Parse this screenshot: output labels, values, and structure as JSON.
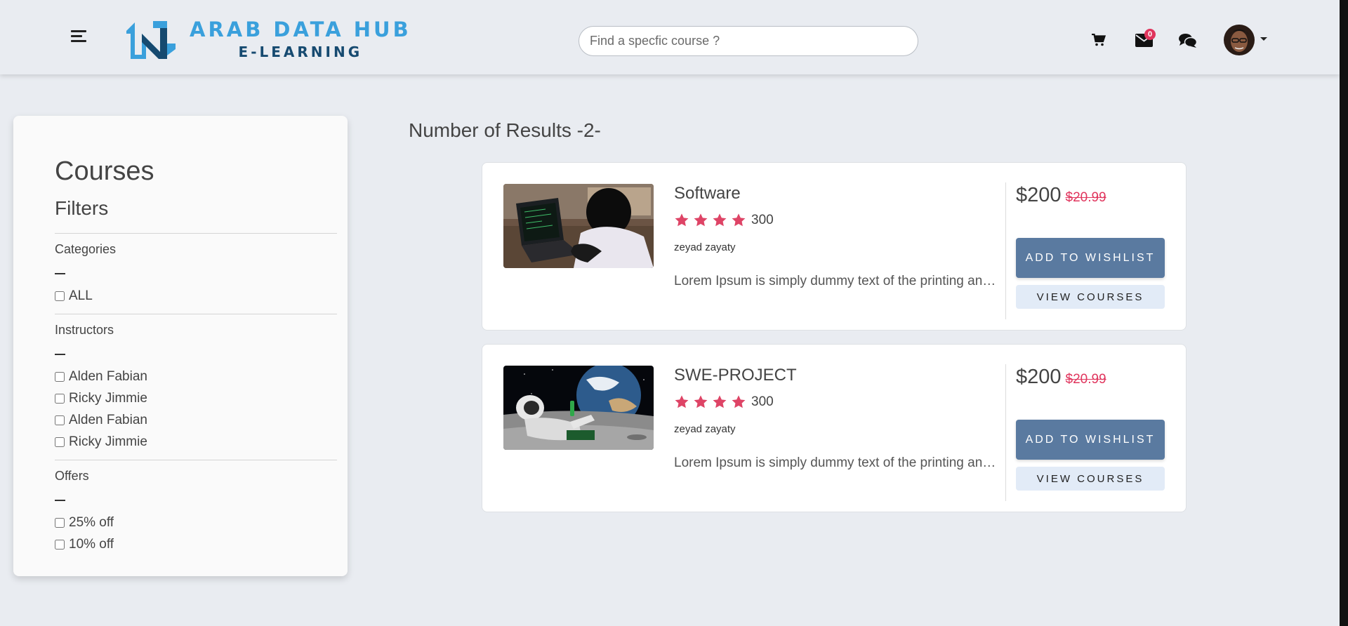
{
  "header": {
    "logo_title": "ARAB DATA HUB",
    "logo_subtitle": "E-LEARNING",
    "search_placeholder": "Find a specfic course ?",
    "messages_badge": "0",
    "icons": [
      "menu-icon",
      "cart-icon",
      "envelope-icon",
      "chat-icon",
      "avatar",
      "caret-down-icon"
    ],
    "colors": {
      "brand_light": "#3aa0dc",
      "brand_dark": "#164a70",
      "badge": "#e0355d"
    }
  },
  "sidebar": {
    "title": "Courses",
    "subtitle": "Filters",
    "categories": {
      "label": "Categories",
      "options": [
        "ALL"
      ]
    },
    "instructors": {
      "label": "Instructors",
      "options": [
        "Alden Fabian",
        "Ricky Jimmie",
        "Alden Fabian",
        "Ricky Jimmie"
      ]
    },
    "offers": {
      "label": "Offers",
      "options": [
        "25% off",
        "10% off"
      ]
    }
  },
  "results": {
    "count_label": "Number of Results -2-",
    "courses": [
      {
        "title": "Software",
        "rating_stars": 4,
        "rating_count": "300",
        "instructor": "zeyad zayaty",
        "description": "Lorem Ipsum is simply dummy text of the printing and typesetting industry.",
        "price": "$200",
        "old_price": "$20.99",
        "wishlist_label": "ADD TO WISHLIST",
        "view_label": "VIEW COURSES"
      },
      {
        "title": "SWE-PROJECT",
        "rating_stars": 4,
        "rating_count": "300",
        "instructor": "zeyad zayaty",
        "description": "Lorem Ipsum is simply dummy text of the printing and typesetting industry.",
        "price": "$200",
        "old_price": "$20.99",
        "wishlist_label": "ADD TO WISHLIST",
        "view_label": "VIEW COURSES"
      }
    ],
    "colors": {
      "star": "#de4466",
      "wishlist_button": "#5a7aa0",
      "view_button": "#e2ebf7"
    }
  }
}
